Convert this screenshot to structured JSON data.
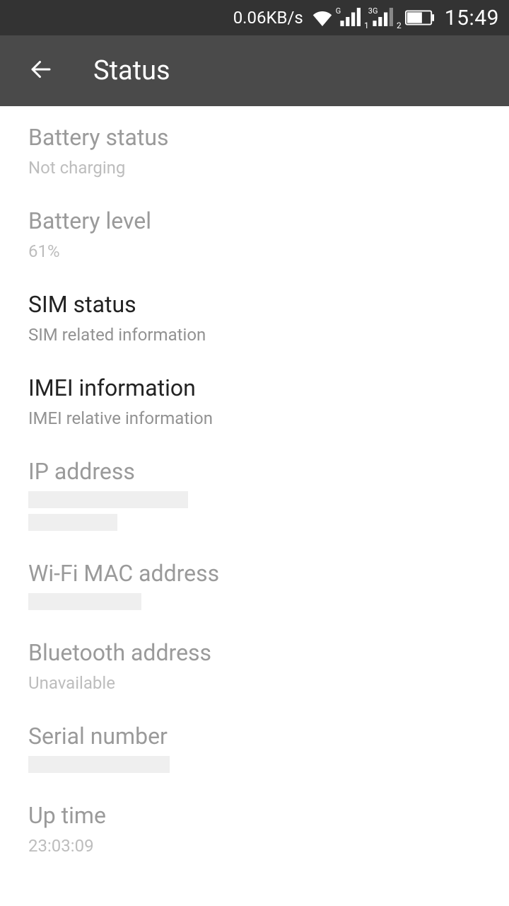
{
  "system_bar": {
    "netspeed": "0.06KB/s",
    "time": "15:49"
  },
  "app_bar": {
    "title": "Status"
  },
  "rows": [
    {
      "label": "Battery status",
      "value": "Not charging",
      "interactable": false,
      "redacted": false
    },
    {
      "label": "Battery level",
      "value": "61%",
      "interactable": false,
      "redacted": false
    },
    {
      "label": "SIM status",
      "value": "SIM related information",
      "interactable": true,
      "redacted": false
    },
    {
      "label": "IMEI information",
      "value": "IMEI relative information",
      "interactable": true,
      "redacted": false
    },
    {
      "label": "IP address",
      "value": "",
      "interactable": false,
      "redacted": true,
      "redact_widths": [
        226,
        126
      ]
    },
    {
      "label": "Wi-Fi MAC address",
      "value": "",
      "interactable": false,
      "redacted": true,
      "redact_widths": [
        160
      ]
    },
    {
      "label": "Bluetooth address",
      "value": "Unavailable",
      "interactable": false,
      "redacted": false
    },
    {
      "label": "Serial number",
      "value": "",
      "interactable": false,
      "redacted": true,
      "redact_widths": [
        200
      ]
    },
    {
      "label": "Up time",
      "value": "23:03:09",
      "interactable": false,
      "redacted": false
    }
  ]
}
